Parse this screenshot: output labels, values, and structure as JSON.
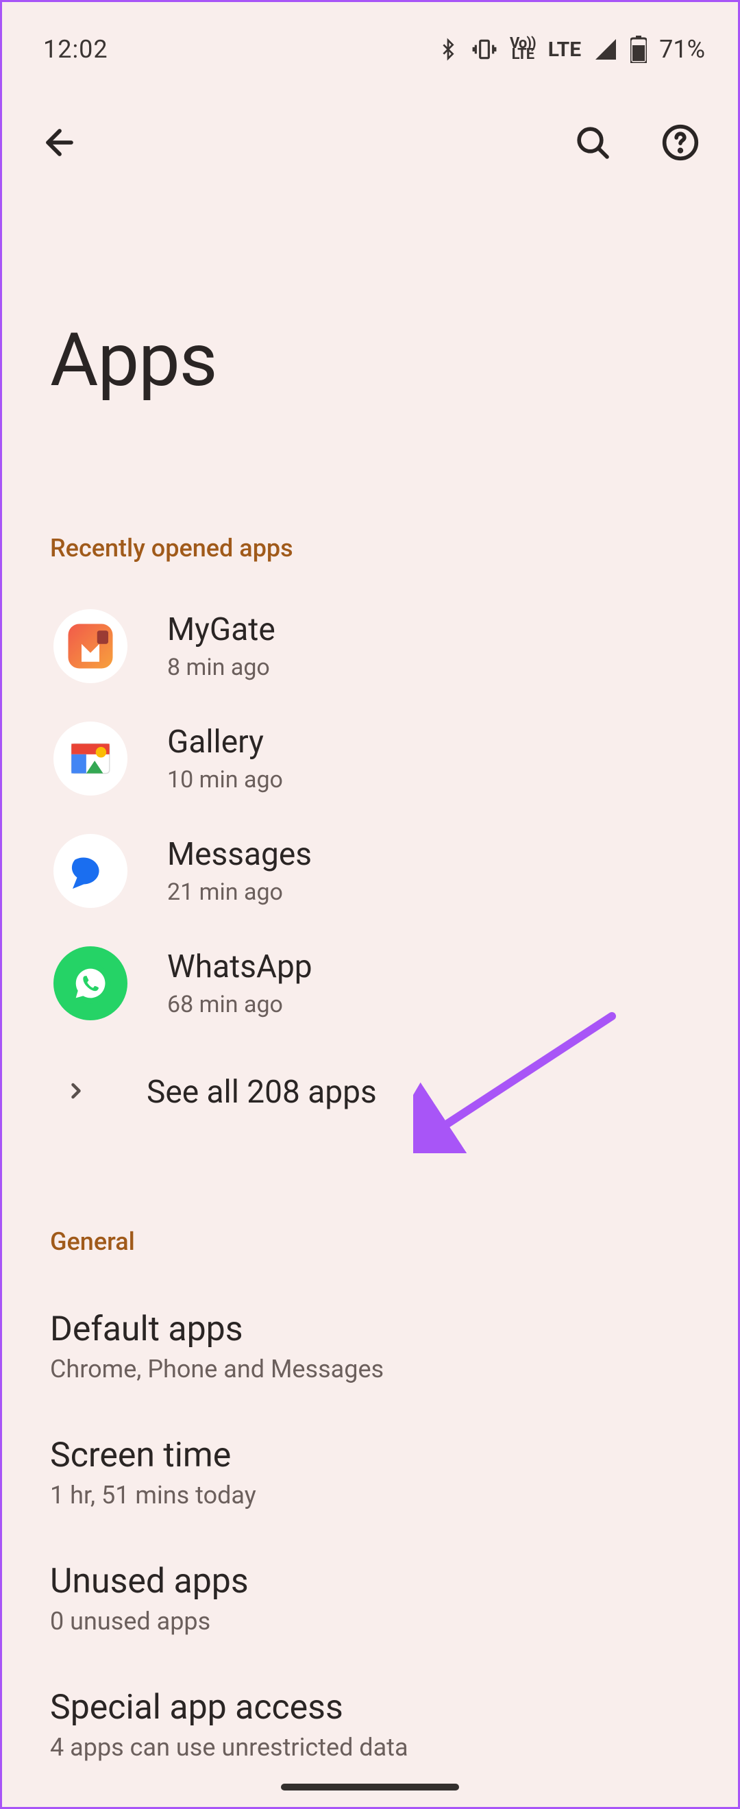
{
  "status_bar": {
    "time": "12:02",
    "battery": "71%"
  },
  "page": {
    "title": "Apps"
  },
  "recent": {
    "header": "Recently opened apps",
    "items": [
      {
        "name": "MyGate",
        "sub": "8 min ago"
      },
      {
        "name": "Gallery",
        "sub": "10 min ago"
      },
      {
        "name": "Messages",
        "sub": "21 min ago"
      },
      {
        "name": "WhatsApp",
        "sub": "68 min ago"
      }
    ],
    "see_all": "See all 208 apps"
  },
  "general": {
    "header": "General",
    "items": [
      {
        "title": "Default apps",
        "sub": "Chrome, Phone and Messages"
      },
      {
        "title": "Screen time",
        "sub": "1 hr, 51 mins today"
      },
      {
        "title": "Unused apps",
        "sub": "0 unused apps"
      },
      {
        "title": "Special app access",
        "sub": "4 apps can use unrestricted data"
      }
    ]
  }
}
